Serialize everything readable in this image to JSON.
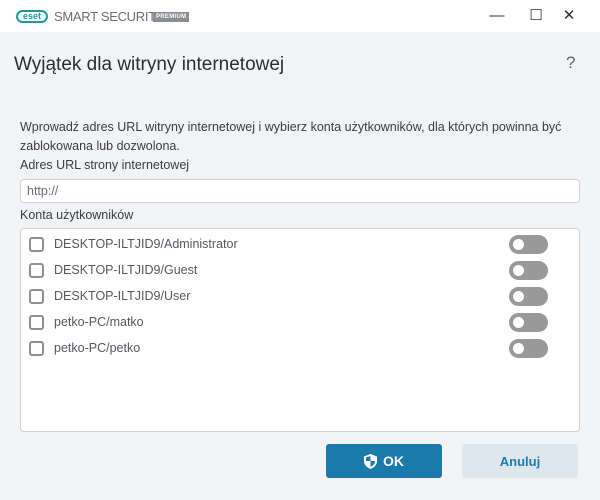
{
  "titlebar": {
    "logo": "eset",
    "brand": "SMART SECURITY",
    "edition": "PREMIUM",
    "minimize": "—",
    "maximize": "☐",
    "close": "✕"
  },
  "dialog": {
    "title": "Wyjątek dla witryny internetowej",
    "help": "?",
    "description": "Wprowadź adres URL witryny internetowej i wybierz konta użytkowników, dla których powinna być zablokowana lub dozwolona.",
    "url_label": "Adres URL strony internetowej",
    "url_value": "http://",
    "accounts_label": "Konta użytkowników",
    "accounts": [
      {
        "name": "DESKTOP-ILTJID9/Administrator",
        "checked": false,
        "toggle": false
      },
      {
        "name": "DESKTOP-ILTJID9/Guest",
        "checked": false,
        "toggle": false
      },
      {
        "name": "DESKTOP-ILTJID9/User",
        "checked": false,
        "toggle": false
      },
      {
        "name": "petko-PC/matko",
        "checked": false,
        "toggle": false
      },
      {
        "name": "petko-PC/petko",
        "checked": false,
        "toggle": false
      }
    ],
    "ok": "OK",
    "cancel": "Anuluj"
  }
}
